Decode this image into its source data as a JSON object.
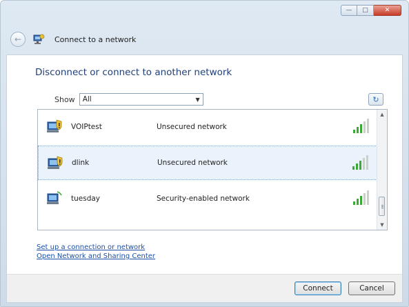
{
  "window": {
    "controls": {
      "minimize": "—",
      "maximize": "□",
      "close": "✕"
    }
  },
  "nav": {
    "title": "Connect to a network",
    "back_glyph": "←"
  },
  "heading": "Disconnect or connect to another network",
  "show": {
    "label": "Show",
    "value": "All",
    "arrow": "▼"
  },
  "refresh_glyph": "↻",
  "networks": [
    {
      "ssid": "VOIPtest",
      "security": "Unsecured network",
      "selected": false,
      "shield": true
    },
    {
      "ssid": "dlink",
      "security": "Unsecured network",
      "selected": true,
      "shield": true
    },
    {
      "ssid": "tuesday",
      "security": "Security-enabled network",
      "selected": false,
      "shield": false
    }
  ],
  "scrollbar": {
    "up": "▲",
    "down": "▼"
  },
  "links": {
    "setup": "Set up a connection or network",
    "sharing": "Open Network and Sharing Center"
  },
  "buttons": {
    "connect": "Connect",
    "cancel": "Cancel"
  },
  "colors": {
    "heading": "#1f3f7a",
    "link": "#1b4fa6",
    "selected_row": "#eaf3fb",
    "signal_green": "#3aa935"
  }
}
